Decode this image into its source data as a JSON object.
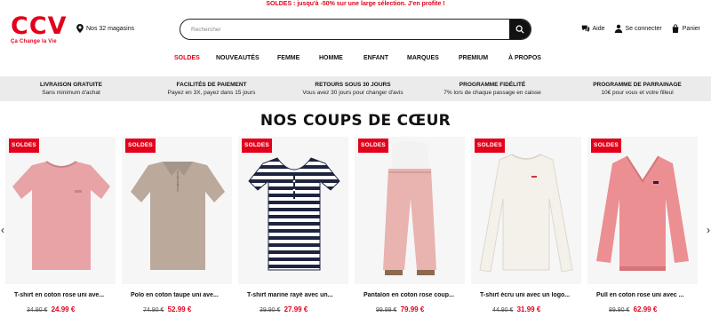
{
  "promo": "SOLDES : jusqu'à -50% sur une large sélection. J'en profite !",
  "brand": {
    "logo": "CCV",
    "tagline": "Ça Change la Vie",
    "accent": "#e3001b"
  },
  "header": {
    "stores_label": "Nos 32 magasins",
    "search_placeholder": "Rechercher",
    "help_label": "Aide",
    "login_label": "Se connecter",
    "cart_label": "Panier"
  },
  "nav": [
    {
      "label": "SOLDES"
    },
    {
      "label": "NOUVEAUTÉS"
    },
    {
      "label": "FEMME"
    },
    {
      "label": "HOMME"
    },
    {
      "label": "ENFANT"
    },
    {
      "label": "MARQUES"
    },
    {
      "label": "PREMIUM"
    },
    {
      "label": "À PROPOS"
    }
  ],
  "benefits": [
    {
      "title": "LIVRAISON GRATUITE",
      "subtitle": "Sans minimum d'achat"
    },
    {
      "title": "FACILITÉS DE PAIEMENT",
      "subtitle": "Payez en 3X, payez dans 15 jours"
    },
    {
      "title": "RETOURS SOUS 30 JOURS",
      "subtitle": "Vous avez 30 jours pour changer d'avis"
    },
    {
      "title": "PROGRAMME FIDÉLITÉ",
      "subtitle": "7% lors de chaque passage en caisse"
    },
    {
      "title": "PROGRAMME DE PARRAINAGE",
      "subtitle": "10€ pour vous et votre filleul"
    }
  ],
  "section_title": "NOS COUPS DE CŒUR",
  "sale_tag": "SOLDES",
  "products": [
    {
      "name": "T-shirt en coton rose uni ave...",
      "old_price": "34.90 €",
      "new_price": "24.99 €",
      "item_color": "#e8a3a6"
    },
    {
      "name": "Polo en coton taupe uni ave...",
      "old_price": "74.90 €",
      "new_price": "52.99 €",
      "item_color": "#bba99c"
    },
    {
      "name": "T-shirt marine rayé avec un...",
      "old_price": "39.90 €",
      "new_price": "27.99 €",
      "item_color": "#1d2440"
    },
    {
      "name": "Pantalon en coton rose coup...",
      "old_price": "99.99 €",
      "new_price": "79.99 €",
      "item_color": "#e9b3b0"
    },
    {
      "name": "T-shirt écru uni avec un logo...",
      "old_price": "44.90 €",
      "new_price": "31.99 €",
      "item_color": "#f4f1ea"
    },
    {
      "name": "Pull en coton rose uni avec ...",
      "old_price": "89.90 €",
      "new_price": "62.99 €",
      "item_color": "#ec8f92"
    }
  ]
}
